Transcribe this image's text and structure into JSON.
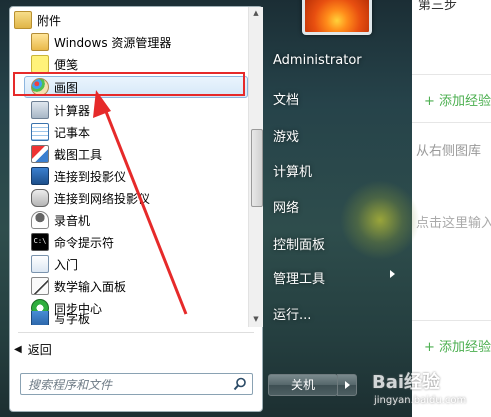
{
  "background_page": {
    "step_text": "第三步",
    "add_label_1": "+ 添加经验",
    "image_hint": "从右侧图库",
    "click_hint": "点击这里输入",
    "add_label_2": "+ 添加经验"
  },
  "folder": {
    "label": "附件"
  },
  "programs": [
    {
      "label": "Windows 资源管理器",
      "icon": "folder-explorer-icon"
    },
    {
      "label": "便笺",
      "icon": "sticky-note-icon"
    },
    {
      "label": "画图",
      "icon": "paint-palette-icon"
    },
    {
      "label": "计算器",
      "icon": "calculator-icon"
    },
    {
      "label": "记事本",
      "icon": "notepad-icon"
    },
    {
      "label": "截图工具",
      "icon": "snipping-tool-icon"
    },
    {
      "label": "连接到投影仪",
      "icon": "projector-icon"
    },
    {
      "label": "连接到网络投影仪",
      "icon": "network-projector-icon"
    },
    {
      "label": "录音机",
      "icon": "microphone-icon"
    },
    {
      "label": "命令提示符",
      "icon": "command-prompt-icon"
    },
    {
      "label": "入门",
      "icon": "getting-started-icon"
    },
    {
      "label": "数学输入面板",
      "icon": "math-input-icon"
    },
    {
      "label": "同步中心",
      "icon": "sync-center-icon"
    },
    {
      "label": "写字板",
      "icon": "wordpad-icon"
    }
  ],
  "back_label": "返回",
  "search": {
    "placeholder": "搜索程序和文件"
  },
  "right_panel": {
    "items": [
      "Administrator",
      "文档",
      "游戏",
      "计算机",
      "网络",
      "控制面板",
      "管理工具",
      "运行..."
    ]
  },
  "shutdown_label": "关机",
  "watermark": {
    "main": "Bai经验",
    "sub": "jingyan.baidu.com"
  },
  "colors": {
    "highlight_border": "#e62a2a",
    "accent_green": "#4caf50"
  }
}
